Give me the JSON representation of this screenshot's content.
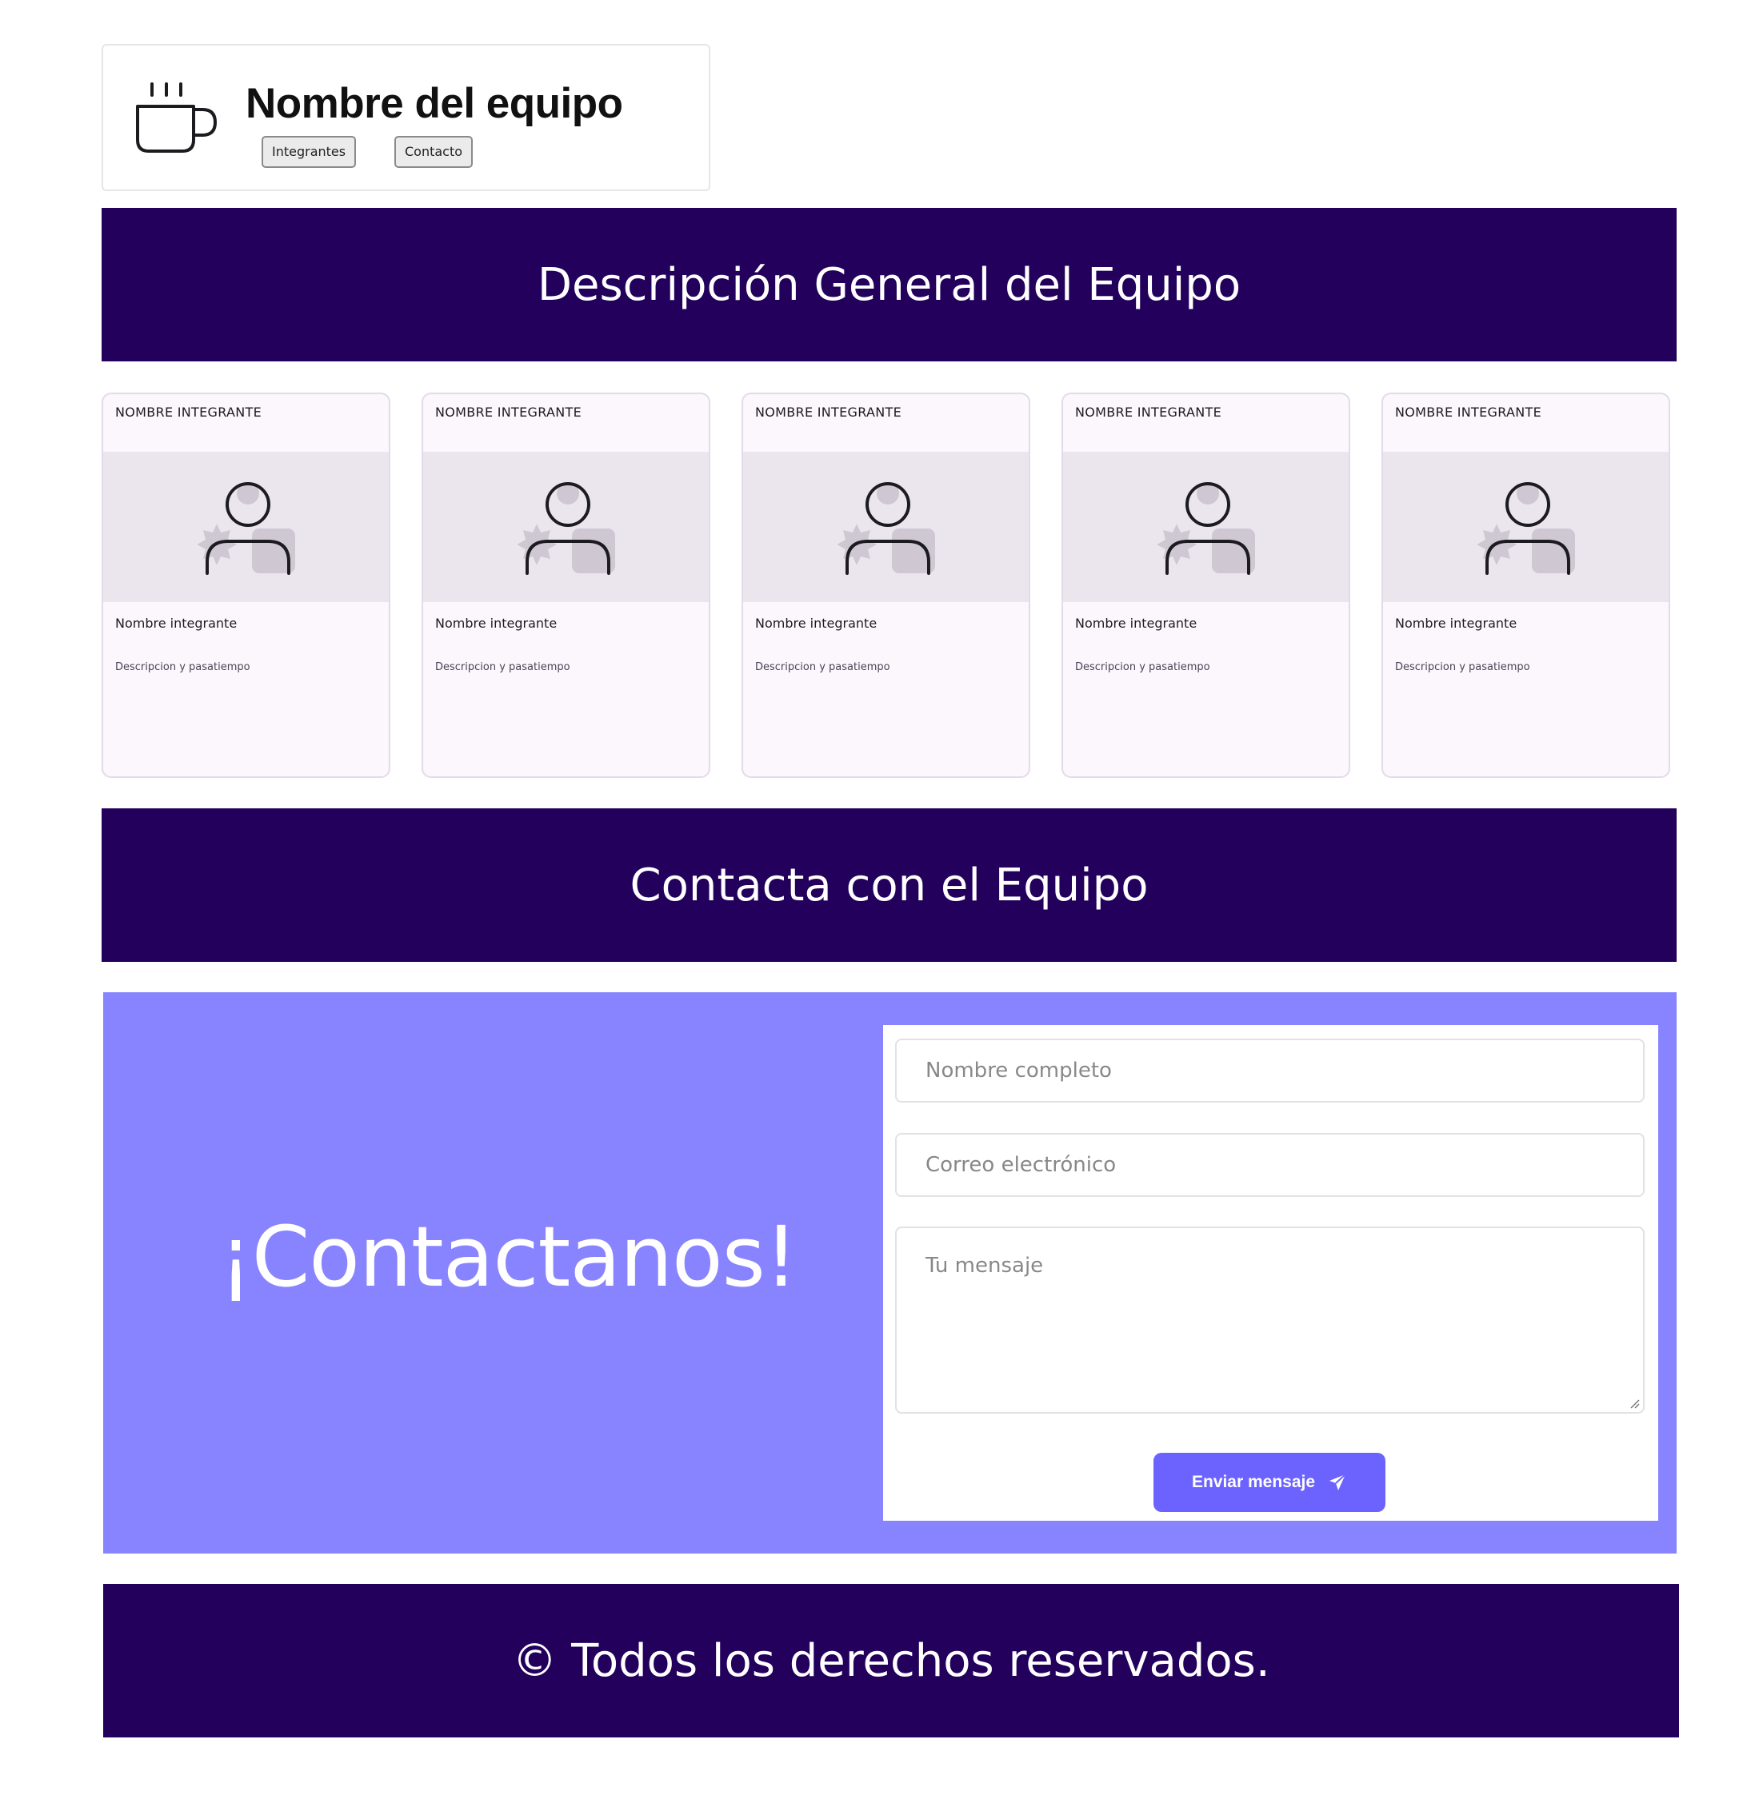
{
  "header": {
    "team_name": "Nombre del equipo",
    "nav": {
      "members_label": "Integrantes",
      "contact_label": "Contacto"
    },
    "logo_icon": "coffee-cup-icon"
  },
  "sections": {
    "description_title": "Descripción General del Equipo",
    "contact_title": "Contacta con el Equipo"
  },
  "members": [
    {
      "header": "NOMBRE INTEGRANTE",
      "name": "Nombre integrante",
      "description": "Descripcion y pasatiempo",
      "icon": "person-placeholder-icon"
    },
    {
      "header": "NOMBRE INTEGRANTE",
      "name": "Nombre integrante",
      "description": "Descripcion y pasatiempo",
      "icon": "person-placeholder-icon"
    },
    {
      "header": "NOMBRE INTEGRANTE",
      "name": "Nombre integrante",
      "description": "Descripcion y pasatiempo",
      "icon": "person-placeholder-icon"
    },
    {
      "header": "NOMBRE INTEGRANTE",
      "name": "Nombre integrante",
      "description": "Descripcion y pasatiempo",
      "icon": "person-placeholder-icon"
    },
    {
      "header": "NOMBRE INTEGRANTE",
      "name": "Nombre integrante",
      "description": "Descripcion y pasatiempo",
      "icon": "person-placeholder-icon"
    }
  ],
  "contact": {
    "heading": "¡Contactanos!",
    "form": {
      "name_placeholder": "Nombre completo",
      "email_placeholder": "Correo electrónico",
      "message_placeholder": "Tu mensaje",
      "submit_label": "Enviar mensaje",
      "submit_icon": "paper-plane-icon"
    }
  },
  "footer": {
    "text": "© Todos los derechos reservados."
  },
  "colors": {
    "banner": "#22005c",
    "contact_bg": "#8884ff",
    "button": "#6c63ff",
    "card_bg": "#fcf6fd"
  }
}
